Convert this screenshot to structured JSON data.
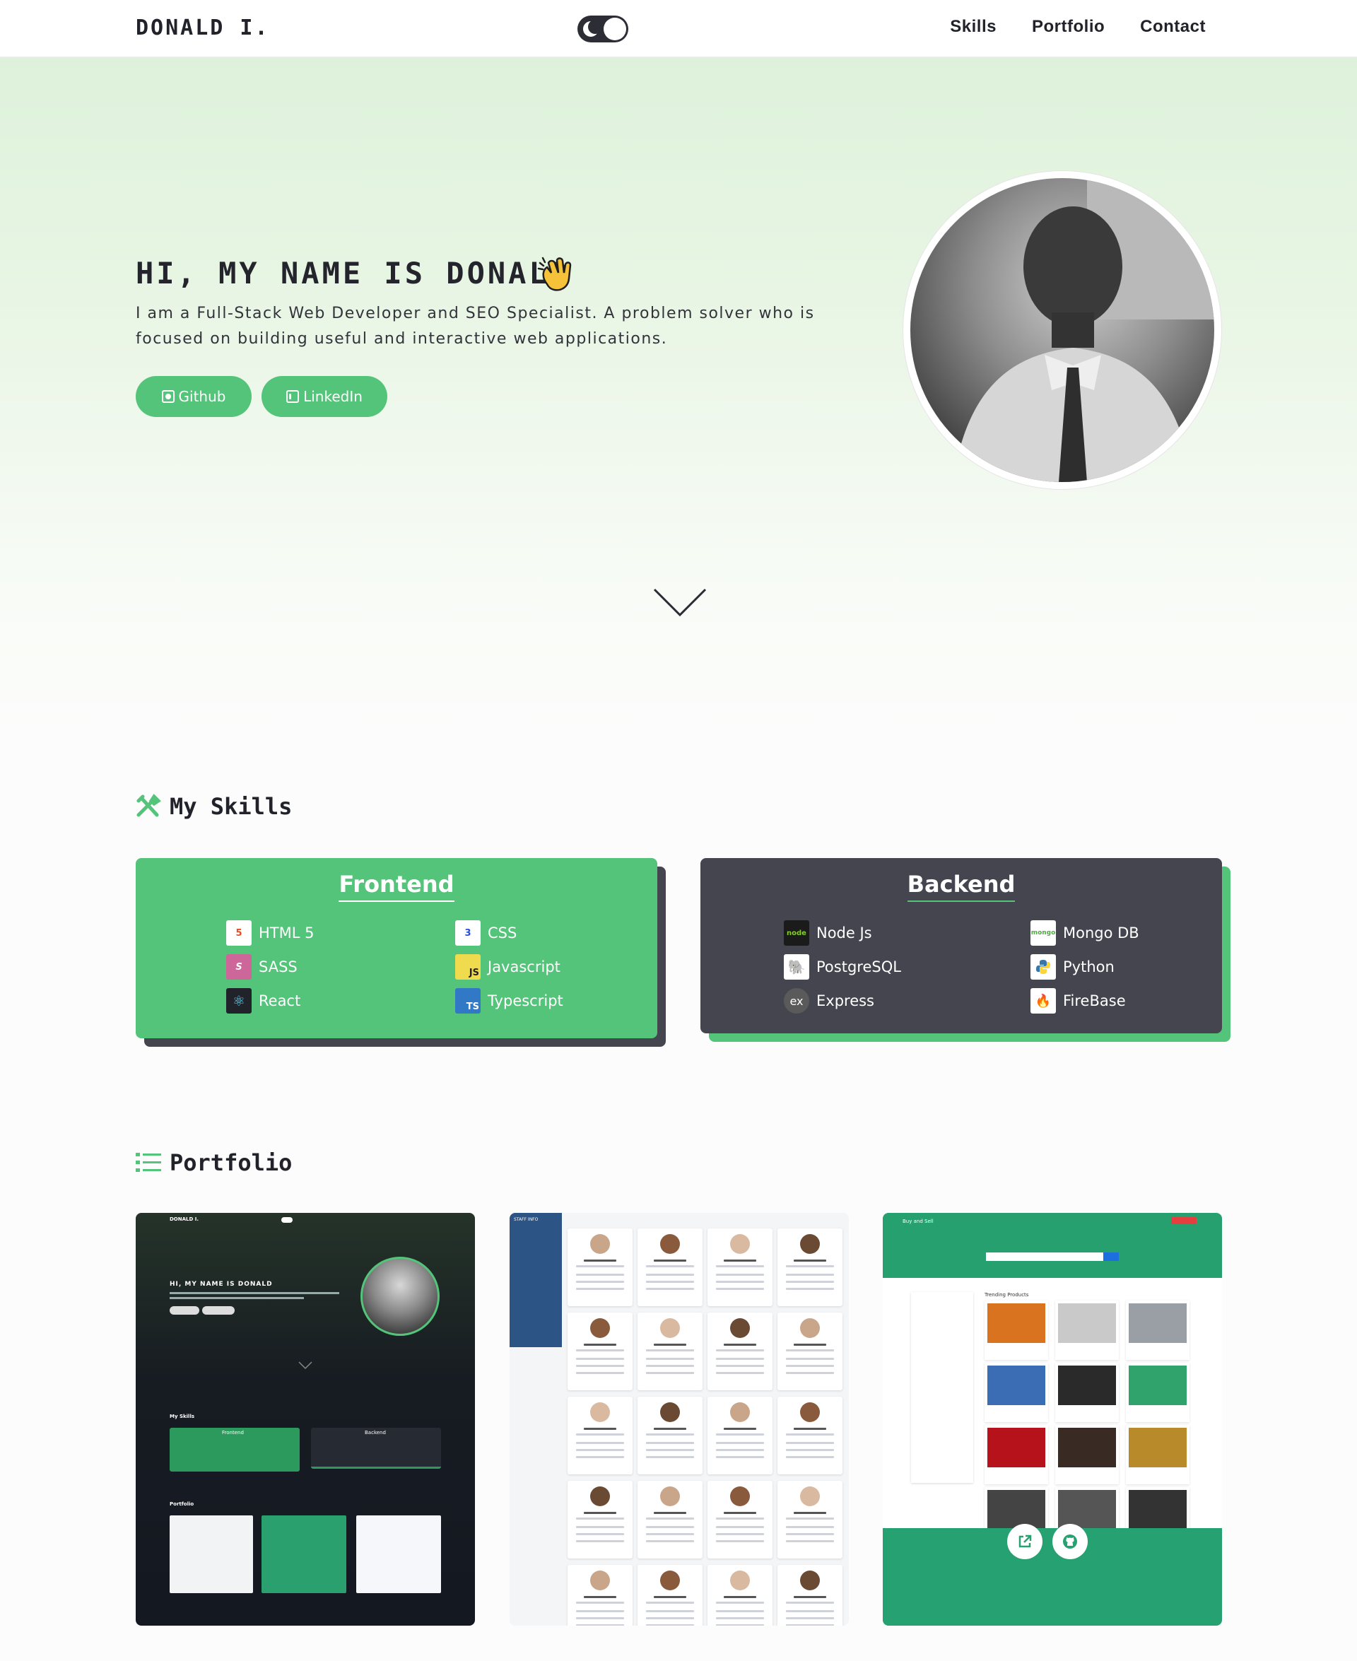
{
  "nav": {
    "brand": "DONALD I.",
    "links": [
      "Skills",
      "Portfolio",
      "Contact"
    ]
  },
  "hero": {
    "title": "HI, MY NAME IS DONALD",
    "description": "I am a Full-Stack Web Developer and SEO Specialist. A problem solver who is focused on building useful and interactive web applications.",
    "buttons": {
      "github": "Github",
      "linkedin": "LinkedIn"
    }
  },
  "skills": {
    "heading": "My Skills",
    "frontend": {
      "title": "Frontend",
      "items": [
        "HTML 5",
        "CSS",
        "SASS",
        "Javascript",
        "React",
        "Typescript"
      ]
    },
    "backend": {
      "title": "Backend",
      "items": [
        "Node Js",
        "Mongo DB",
        "PostgreSQL",
        "Python",
        "Express",
        "FireBase"
      ]
    }
  },
  "portfolio": {
    "heading": "Portfolio",
    "preview1": {
      "brand": "DONALD I.",
      "title": "HI, MY NAME IS DONALD",
      "skills_heading": "My Skills",
      "portfolio_heading": "Portfolio",
      "frontend": "Frontend",
      "backend": "Backend"
    },
    "preview2": {
      "brand": "STAFF INFO"
    },
    "preview3": {
      "brand": "Buy and Sell",
      "section": "Trending Products"
    }
  },
  "colors": {
    "accent": "#53c479",
    "dark": "#45454f",
    "shop_green": "#27a070",
    "staff_blue": "#2c5485"
  },
  "icons": {
    "toggle": "theme-toggle-icon",
    "skills": "tools-icon",
    "portfolio": "list-icon",
    "scroll": "chevron-down-icon",
    "wave": "waving-hand-icon"
  }
}
